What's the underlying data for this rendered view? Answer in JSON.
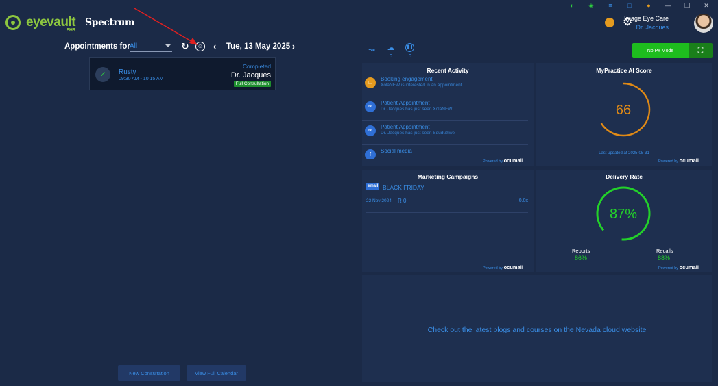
{
  "header": {
    "logo_text": "eyevault",
    "logo_sub": "EHR",
    "brand2": "Spectrum",
    "practice_name": "Image Eye Care",
    "doctor_name": "Dr. Jacques",
    "system_icons": [
      "link-icon",
      "wifi-icon",
      "network-icon",
      "monitor-icon",
      "bug-icon",
      "minimize-icon",
      "restore-icon",
      "close-icon"
    ]
  },
  "appointments": {
    "label": "Appointments for",
    "filter_value": "All",
    "date": "Tue, 13 May 2025",
    "card": {
      "patient": "Rusty",
      "time": "09:30 AM - 10:15 AM",
      "status": "Completed",
      "doctor": "Dr. Jacques",
      "type": "Full Consultation"
    },
    "new_consult_label": "New Consultation",
    "calendar_label": "View Full Calendar"
  },
  "right_toolbar": {
    "counts": [
      "0",
      "0"
    ],
    "nopx_label": "No Px Mode"
  },
  "recent_activity": {
    "title": "Recent Activity",
    "items": [
      {
        "title": "Booking engagement",
        "subtitle": "XolaNEW is interested in an appointment",
        "icon": "calendar-icon",
        "color": "#e59b1f"
      },
      {
        "title": "Patient Appointment",
        "subtitle": "Dr. Jacques has just seen XolaNEW",
        "icon": "mail-icon",
        "color": "#2f6fd6"
      },
      {
        "title": "Patient Appointment",
        "subtitle": "Dr. Jacques has just seen Sduduziwe",
        "icon": "mail-icon",
        "color": "#2f6fd6"
      },
      {
        "title": "Social media",
        "subtitle": "",
        "icon": "facebook-icon",
        "color": "#2f6fd6"
      }
    ],
    "powered_prefix": "Powered by",
    "powered_brand": "ocumail"
  },
  "ai_score": {
    "title": "MyPractice AI Score",
    "score": "66",
    "score_fraction": 0.66,
    "updated": "Last updated at 2025-05-31",
    "color": "#e08a16",
    "powered_prefix": "Powered by",
    "powered_brand": "ocumail"
  },
  "marketing": {
    "title": "Marketing Campaigns",
    "badge": "email",
    "campaign": "BLACK FRIDAY",
    "date": "22 Nov 2024",
    "amount": "R 0",
    "ratio": "0.0x",
    "powered_prefix": "Powered by",
    "powered_brand": "ocumail"
  },
  "delivery": {
    "title": "Delivery Rate",
    "rate": "87%",
    "rate_fraction": 0.87,
    "reports_label": "Reports",
    "reports_value": "86%",
    "recalls_label": "Recalls",
    "recalls_value": "88%",
    "color": "#23d12a",
    "powered_prefix": "Powered by",
    "powered_brand": "ocumail"
  },
  "blog": {
    "text": "Check out the latest blogs and courses on the Nevada cloud website"
  }
}
